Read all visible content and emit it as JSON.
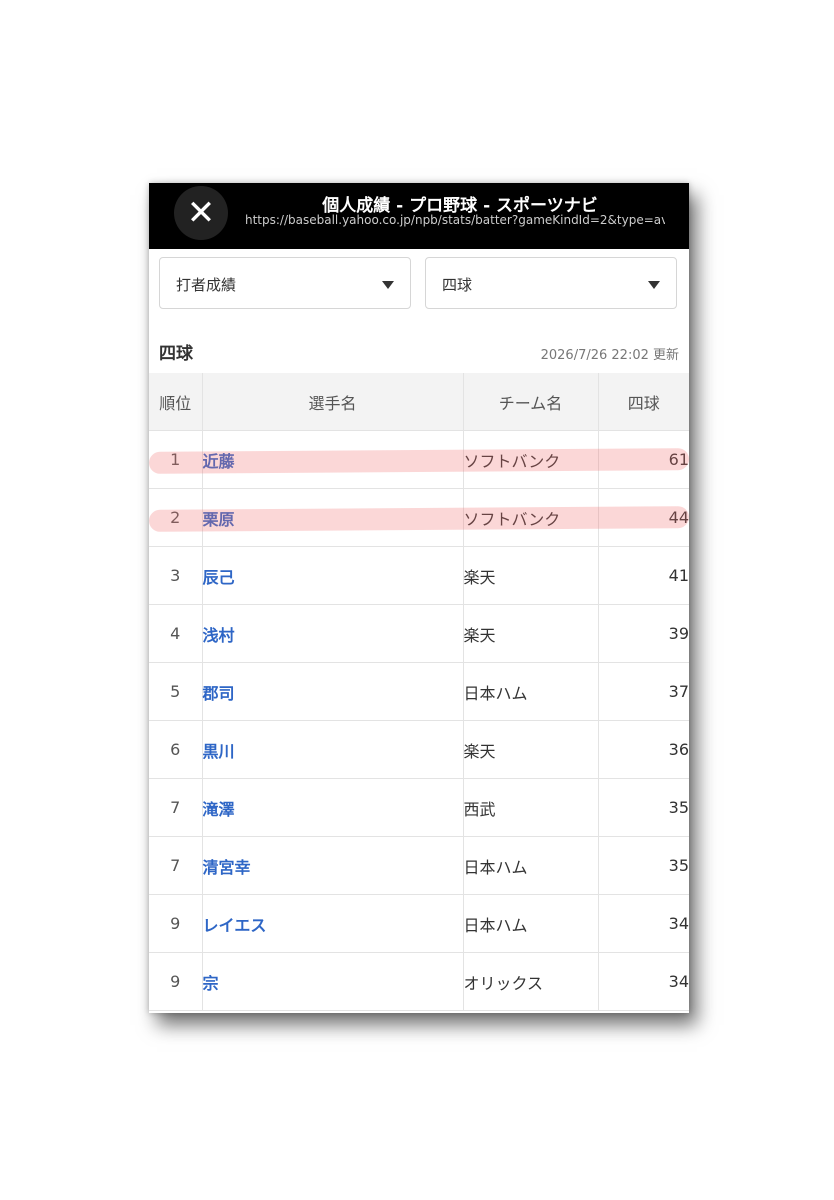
{
  "header": {
    "title": "個人成績 - プロ野球 - スポーツナビ",
    "url": "https://baseball.yahoo.co.jp/npb/stats/batter?gameKindId=2&type=av",
    "close_icon": "close-icon"
  },
  "filters": {
    "category": "打者成績",
    "stat": "四球"
  },
  "section": {
    "title": "四球",
    "updated": "2026/7/26 22:02 更新"
  },
  "table": {
    "columns": [
      "順位",
      "選手名",
      "チーム名",
      "四球"
    ],
    "rows": [
      {
        "rank": "1",
        "name": "近藤",
        "team": "ソフトバンク",
        "value": "61"
      },
      {
        "rank": "2",
        "name": "栗原",
        "team": "ソフトバンク",
        "value": "44"
      },
      {
        "rank": "3",
        "name": "辰己",
        "team": "楽天",
        "value": "41"
      },
      {
        "rank": "4",
        "name": "浅村",
        "team": "楽天",
        "value": "39"
      },
      {
        "rank": "5",
        "name": "郡司",
        "team": "日本ハム",
        "value": "37"
      },
      {
        "rank": "6",
        "name": "黒川",
        "team": "楽天",
        "value": "36"
      },
      {
        "rank": "7",
        "name": "滝澤",
        "team": "西武",
        "value": "35"
      },
      {
        "rank": "7",
        "name": "清宮幸",
        "team": "日本ハム",
        "value": "35"
      },
      {
        "rank": "9",
        "name": "レイエス",
        "team": "日本ハム",
        "value": "34"
      },
      {
        "rank": "9",
        "name": "宗",
        "team": "オリックス",
        "value": "34"
      }
    ]
  },
  "colors": {
    "player_link": "#2e66c6",
    "highlight_marker": "#f06e6e"
  }
}
